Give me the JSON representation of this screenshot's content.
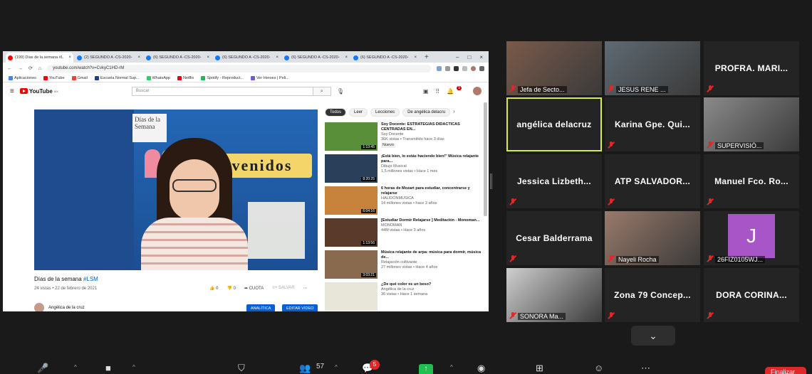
{
  "browser": {
    "tabs": [
      {
        "label": "(199) Días de la semana #L",
        "color": "#ff0000",
        "active": true
      },
      {
        "label": "(2) SEGUNDO A -CS-2020-",
        "color": "#1877f2"
      },
      {
        "label": "(6) SEGUNDO A -CS-2020-",
        "color": "#1877f2"
      },
      {
        "label": "(6) SEGUNDO A -CS-2020-",
        "color": "#1877f2"
      },
      {
        "label": "(6) SEGUNDO A -CS-2020-",
        "color": "#1877f2"
      },
      {
        "label": "(6) SEGUNDO A -CS-2020-",
        "color": "#1877f2"
      }
    ],
    "new_tab": "+",
    "url": "youtube.com/watch?v=CvkyC1HD-rM",
    "bookmarks": [
      "Aplicaciones",
      "YouTube",
      "Gmail",
      "Escuela Normal Sup...",
      "WhatsApp",
      "Netflix",
      "Spotify - Reproduct...",
      "Ver Heroes | Peli..."
    ],
    "bookmark_colors": [
      "#4285f4",
      "#ff0000",
      "#ea4335",
      "#1d3f8f",
      "#25d366",
      "#e50914",
      "#1db954",
      "#6b5ccf"
    ]
  },
  "youtube": {
    "logo": "YouTube",
    "logo_sup": "MX",
    "search_placeholder": "Buscar",
    "notifications": "9",
    "video": {
      "title_main": "Días de la semana ",
      "title_tag": "#LSM",
      "meta": "24 vistas • 22 de febrero de 2021",
      "likes": "0",
      "dislikes": "0",
      "share": "CUOTA",
      "save": "SALVAR",
      "overlay_text": "venidos",
      "board_text": "Días de la Semana"
    },
    "channel": "Angélica de la cruz",
    "btn_analytics": "ANALÍTICA",
    "btn_edit": "EDITAR VIDEO",
    "chips": [
      "Todos",
      "Leer",
      "Lecciones",
      "De angélica delacru"
    ],
    "recommended": [
      {
        "title": "Soy Docente: ESTRATEGIAS DIDÁCTICAS CENTRADAS EN...",
        "channel": "Soy Docente",
        "views": "36K vistas",
        "age": "Transmitido hace 3 días",
        "badge": "Nuevo",
        "duration": "1:13:45",
        "thumb": "#5a8f3a"
      },
      {
        "title": "¡Está bien, lo estás haciendo bien!\" Música relajante para...",
        "channel": "Dibujo Musical",
        "views": "1,5 millones vistas",
        "age": "Hace 1 mes",
        "badge": "",
        "duration": "8:20:25",
        "thumb": "#2a3f5a"
      },
      {
        "title": "6 horas de Mozart para estudiar, concentrarse y relajarse",
        "channel": "HALIDONMUSICA",
        "views": "14 millones vistas",
        "age": "hace 3 años",
        "badge": "",
        "duration": "6:04:16",
        "thumb": "#c7823b"
      },
      {
        "title": "[Estudiar Dormir Relajarse ] Meditación - Monoman...",
        "channel": "MONOMAN",
        "views": "44M vistas",
        "age": "Hace 3 años",
        "badge": "",
        "duration": "1:13:56",
        "thumb": "#5a3a2a"
      },
      {
        "title": "Música relajante de arpa: música para dormir, música de...",
        "channel": "Relajación cultivante",
        "views": "27 millones vistas",
        "age": "Hace 4 años",
        "badge": "",
        "duration": "3:03:21",
        "thumb": "#8a6a4f"
      },
      {
        "title": "¿De qué color es un beso?",
        "channel": "Angélica de la cruz",
        "views": "36 vistas",
        "age": "Hace 1 semana",
        "badge": "",
        "duration": "",
        "thumb": "#e8e6d8"
      }
    ]
  },
  "participants": [
    {
      "name": "Jefa de Secto...",
      "video": true,
      "bg": "#7a5a4a",
      "row": 0,
      "col": 0
    },
    {
      "name": "JESUS RENE ...",
      "video": true,
      "bg": "#5f6a73",
      "row": 0,
      "col": 1
    },
    {
      "name": "PROFRA. MARI...",
      "video": false,
      "row": 0,
      "col": 2
    },
    {
      "name": "angélica delacruz",
      "video": false,
      "active": true,
      "row": 1,
      "col": 0
    },
    {
      "name": "Karina Gpe. Qui...",
      "video": false,
      "row": 1,
      "col": 1
    },
    {
      "name": "SUPERVISIÓ...",
      "video": true,
      "bg": "#8a8a8a",
      "row": 1,
      "col": 2
    },
    {
      "name": "Jessica Lizbeth...",
      "video": false,
      "row": 2,
      "col": 0
    },
    {
      "name": "ATP SALVADOR...",
      "video": false,
      "row": 2,
      "col": 1
    },
    {
      "name": "Manuel Fco. Ro...",
      "video": false,
      "row": 2,
      "col": 2
    },
    {
      "name": "Cesar Balderrama",
      "video": false,
      "row": 3,
      "col": 0
    },
    {
      "name": "Nayeli Rocha",
      "video": true,
      "bg": "#9a7a6a",
      "row": 3,
      "col": 1
    },
    {
      "name": "26FIZ0105WJ...",
      "video": false,
      "avatar": "J",
      "row": 3,
      "col": 2
    },
    {
      "name": "SONORA Ma...",
      "video": true,
      "bg": "#cfcfcf",
      "row": 4,
      "col": 0
    },
    {
      "name": "Zona 79 Concep...",
      "video": false,
      "row": 4,
      "col": 1
    },
    {
      "name": "DORA CORINA...",
      "video": false,
      "row": 4,
      "col": 2
    }
  ],
  "toolbar": {
    "participants_count": "57",
    "chat_badge": "5",
    "end": "Finalizar"
  },
  "colors": {
    "accent_active": "#d9e84c",
    "muted_red": "#e02828",
    "share_green": "#1fbf50"
  }
}
